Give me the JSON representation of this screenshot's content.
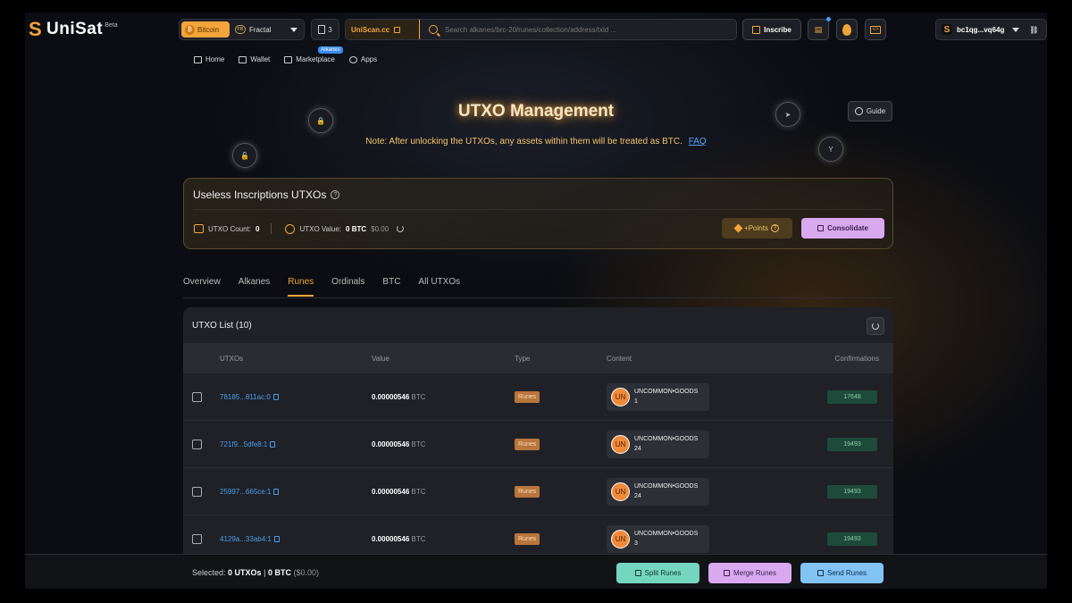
{
  "header": {
    "logo_text": "UniSat",
    "logo_beta": "Beta",
    "network": {
      "btc_label": "Bitcoin",
      "fractal_label": "Fractal"
    },
    "counter": "3",
    "uniscan_label": "UniScan.cc",
    "search_placeholder": "Search alkanes/brc-20/runes/collection/address/txid ...",
    "inscribe_label": "Inscribe",
    "wallet_address": "bc1qg...vq64g"
  },
  "nav": {
    "items": [
      {
        "label": "Home",
        "icon": "home-icon"
      },
      {
        "label": "Wallet",
        "icon": "wallet-icon"
      },
      {
        "label": "Marketplace",
        "icon": "bag-icon",
        "badge": "Alkanes"
      },
      {
        "label": "Apps",
        "icon": "apps-icon"
      }
    ]
  },
  "hero": {
    "title": "UTXO Management",
    "note": "Note: After unlocking the UTXOs, any assets within them will be treated as BTC.",
    "faq": "FAQ",
    "guide": "Guide"
  },
  "useless": {
    "title": "Useless Inscriptions UTXOs",
    "count_label": "UTXO Count:",
    "count": "0",
    "value_label": "UTXO Value:",
    "value_btc": "0 BTC",
    "value_usd": "$0.00",
    "points_label": "+Points",
    "consolidate_label": "Consolidate"
  },
  "tabs": [
    "Overview",
    "Alkanes",
    "Runes",
    "Ordinals",
    "BTC",
    "All UTXOs"
  ],
  "active_tab": "Runes",
  "utxo_list": {
    "title": "UTXO List (10)",
    "columns": [
      "UTXOs",
      "Value",
      "Type",
      "Content",
      "Confirmations"
    ],
    "rows": [
      {
        "utxo": "78185...811ac:0",
        "value": "0.00000546",
        "unit": "BTC",
        "type": "Runes",
        "rune_icon": "UN",
        "rune_name": "UNCOMMON•GOODS",
        "rune_amount": "1",
        "confirmations": "17648"
      },
      {
        "utxo": "721f9...5dfe8:1",
        "value": "0.00000546",
        "unit": "BTC",
        "type": "Runes",
        "rune_icon": "UN",
        "rune_name": "UNCOMMON•GOODS",
        "rune_amount": "24",
        "confirmations": "19493"
      },
      {
        "utxo": "25997...665ce:1",
        "value": "0.00000546",
        "unit": "BTC",
        "type": "Runes",
        "rune_icon": "UN",
        "rune_name": "UNCOMMON•GOODS",
        "rune_amount": "24",
        "confirmations": "19493"
      },
      {
        "utxo": "4129a...33ab4:1",
        "value": "0.00000546",
        "unit": "BTC",
        "type": "Runes",
        "rune_icon": "UN",
        "rune_name": "UNCOMMON•GOODS",
        "rune_amount": "3",
        "confirmations": "19493"
      }
    ]
  },
  "footer": {
    "selected_label": "Selected:",
    "selected_count": "0 UTXOs",
    "separator": "|",
    "selected_btc": "0 BTC",
    "selected_usd": "($0.00)",
    "split_label": "Split Runes",
    "merge_label": "Merge Runes",
    "send_label": "Send Runes"
  },
  "colors": {
    "accent": "#f3a43a",
    "link": "#4a9ee8",
    "split": "#75d6bf",
    "merge": "#d9a9f0",
    "send": "#82c3f4"
  }
}
